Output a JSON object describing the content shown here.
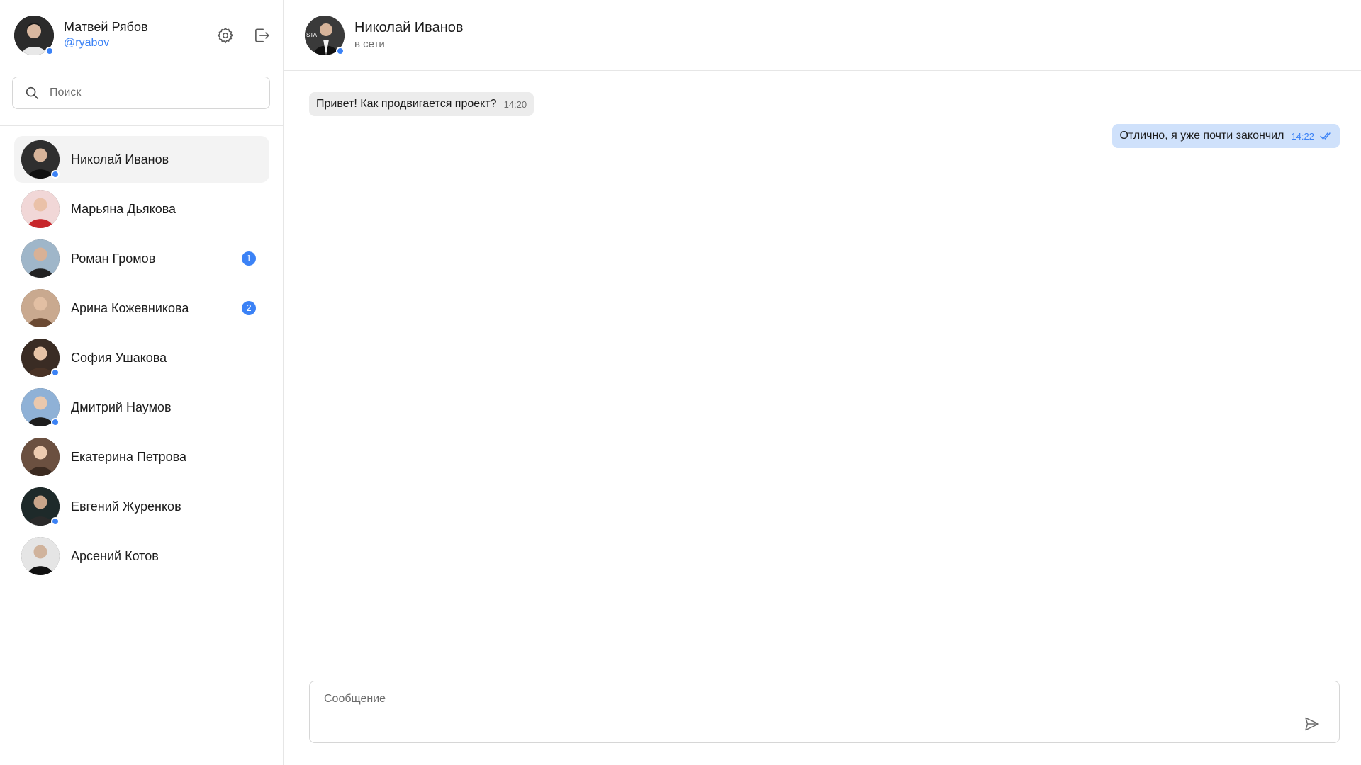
{
  "current_user": {
    "name": "Матвей Рябов",
    "handle": "@ryabov",
    "online": true,
    "avatar_icon": "user-photo"
  },
  "toolbar": {
    "settings_icon": "gear-icon",
    "logout_icon": "logout-icon"
  },
  "search": {
    "placeholder": "Поиск",
    "value": ""
  },
  "contacts": [
    {
      "name": "Николай Иванов",
      "online": true,
      "unread": null,
      "active": true
    },
    {
      "name": "Марьяна Дьякова",
      "online": false,
      "unread": null,
      "active": false
    },
    {
      "name": "Роман Громов",
      "online": false,
      "unread": "1",
      "active": false
    },
    {
      "name": "Арина Кожевникова",
      "online": false,
      "unread": "2",
      "active": false
    },
    {
      "name": "София Ушакова",
      "online": true,
      "unread": null,
      "active": false
    },
    {
      "name": "Дмитрий Наумов",
      "online": true,
      "unread": null,
      "active": false
    },
    {
      "name": "Екатерина Петрова",
      "online": false,
      "unread": null,
      "active": false
    },
    {
      "name": "Евгений Журенков",
      "online": true,
      "unread": null,
      "active": false
    },
    {
      "name": "Арсений Котов",
      "online": false,
      "unread": null,
      "active": false
    }
  ],
  "chat": {
    "peer_name": "Николай Иванов",
    "peer_status": "в сети",
    "messages": [
      {
        "direction": "incoming",
        "text": "Привет! Как продвигается проект?",
        "time": "14:20"
      },
      {
        "direction": "outgoing",
        "text": "Отлично, я уже почти закончил",
        "time": "14:22",
        "read": true
      }
    ]
  },
  "composer": {
    "placeholder": "Сообщение",
    "value": "",
    "send_icon": "send-icon"
  },
  "colors": {
    "accent": "#3b82f6",
    "outgoing_bubble": "#cfe1fb",
    "incoming_bubble": "#ececec",
    "active_contact": "#f3f3f3",
    "border": "#e6e6e6"
  }
}
